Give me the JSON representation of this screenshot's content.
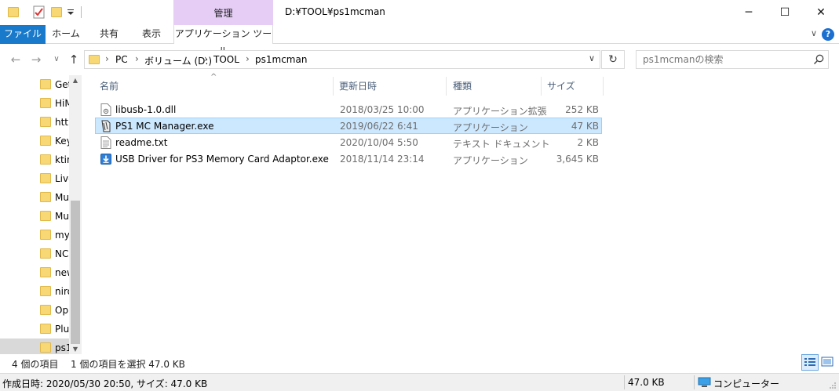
{
  "window": {
    "title": "D:¥TOOL¥ps1mcman",
    "context_tab": "管理",
    "controls": {
      "minimize": "─",
      "maximize": "☐",
      "close": "✕"
    }
  },
  "ribbon": {
    "tabs": [
      {
        "label": "ファイル",
        "active": true
      },
      {
        "label": "ホーム"
      },
      {
        "label": "共有"
      },
      {
        "label": "表示"
      },
      {
        "label": "アプリケーション ツール"
      }
    ],
    "collapse_glyph": "∨",
    "help_glyph": "?"
  },
  "nav": {
    "back": "←",
    "forward": "→",
    "recent": "∨",
    "up": "↑"
  },
  "address": {
    "crumbs": [
      "PC",
      "ボリューム (D:)",
      "TOOL",
      "ps1mcman"
    ],
    "separator": "›",
    "dropdown": "∨",
    "refresh": "↻"
  },
  "search": {
    "placeholder": "ps1mcmanの検索"
  },
  "nav_pane": {
    "items": [
      {
        "label": "Get"
      },
      {
        "label": "HiM"
      },
      {
        "label": "http"
      },
      {
        "label": "Key"
      },
      {
        "label": "ktin"
      },
      {
        "label": "Live"
      },
      {
        "label": "Mu"
      },
      {
        "label": "Mu"
      },
      {
        "label": "my"
      },
      {
        "label": "NC"
      },
      {
        "label": "new"
      },
      {
        "label": "niro"
      },
      {
        "label": "Op"
      },
      {
        "label": "Plu"
      },
      {
        "label": "ps1",
        "selected": true
      }
    ],
    "scroll_up": "▲",
    "scroll_down": "▼"
  },
  "columns": {
    "name": "名前",
    "modified": "更新日時",
    "type": "種類",
    "size": "サイズ",
    "sort_indicator": "^"
  },
  "files": [
    {
      "name": "libusb-1.0.dll",
      "modified": "2018/03/25 10:00",
      "type": "アプリケーション拡張",
      "size": "252 KB",
      "icon": "dll-file-icon"
    },
    {
      "name": "PS1 MC Manager.exe",
      "modified": "2019/06/22 6:41",
      "type": "アプリケーション",
      "size": "47 KB",
      "icon": "exe-app-icon",
      "selected": true
    },
    {
      "name": "readme.txt",
      "modified": "2020/10/04 5:50",
      "type": "テキスト ドキュメント",
      "size": "2 KB",
      "icon": "text-file-icon"
    },
    {
      "name": "USB Driver for PS3 Memory Card Adaptor.exe",
      "modified": "2018/11/14 23:14",
      "type": "アプリケーション",
      "size": "3,645 KB",
      "icon": "installer-icon"
    }
  ],
  "itembar": {
    "count": "4 個の項目",
    "selection": "1 個の項目を選択  47.0 KB"
  },
  "statusbar": {
    "details": "作成日時: 2020/05/30 20:50, サイズ: 47.0 KB",
    "size": "47.0 KB",
    "location": "コンピューター"
  },
  "colors": {
    "file_tab": "#1979ca",
    "context_tab": "#e5cdf5",
    "selection": "#cce8ff",
    "folder": "#f8d775"
  }
}
